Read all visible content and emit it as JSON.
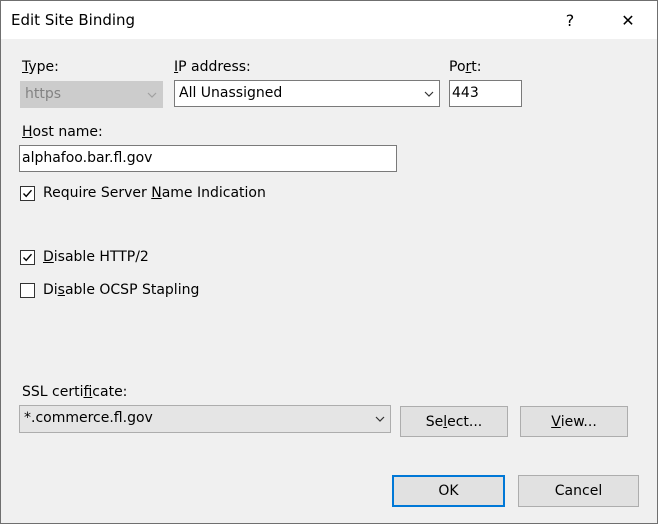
{
  "window": {
    "title": "Edit Site Binding",
    "help_glyph": "?",
    "close_glyph": "✕"
  },
  "type": {
    "label_mnemonic": "T",
    "label_rest": "ype:",
    "value": "https",
    "disabled": true
  },
  "ip_address": {
    "label_mnemonic": "I",
    "label_rest": "P address:",
    "value": "All Unassigned"
  },
  "port": {
    "label_pre": "Po",
    "label_mnemonic": "r",
    "label_rest": "t:",
    "value": "443"
  },
  "host_name": {
    "label_mnemonic": "H",
    "label_rest": "ost name:",
    "value": "alphafoo.bar.fl.gov"
  },
  "require_sni": {
    "label_pre": "Require Server ",
    "label_mnemonic": "N",
    "label_rest": "ame Indication",
    "checked": true
  },
  "disable_http2": {
    "label_pre": "",
    "label_mnemonic": "D",
    "label_rest": "isable HTTP/2",
    "checked": true
  },
  "disable_ocsp": {
    "label_pre": "Di",
    "label_mnemonic": "s",
    "label_rest": "able OCSP Stapling",
    "checked": false
  },
  "ssl_certificate": {
    "label_pre": "SSL certi",
    "label_mnemonic": "f",
    "label_rest": "icate:",
    "value": "*.commerce.fl.gov"
  },
  "buttons": {
    "select_pre": "Se",
    "select_mnemonic": "l",
    "select_rest": "ect...",
    "view_pre": "",
    "view_mnemonic": "V",
    "view_rest": "iew...",
    "ok": "OK",
    "cancel": "Cancel"
  },
  "icons": {
    "chevron": "chevron-down-icon",
    "checkmark": "checkmark-icon"
  },
  "colors": {
    "dialog_bg": "#f0f0f0",
    "default_button_border": "#0078d7",
    "disabled_field_bg": "#cccccc"
  }
}
